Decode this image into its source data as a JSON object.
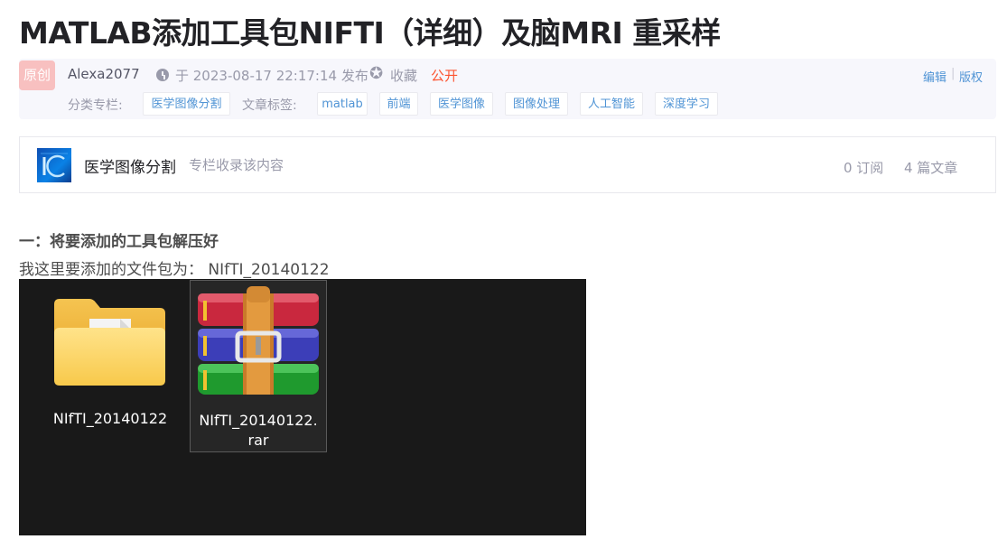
{
  "article": {
    "title": "MATLAB添加工具包NIFTI（详细）及脑MRI 重采样"
  },
  "meta": {
    "badge": "原创",
    "author": "Alexa2077",
    "time": "于 2023-08-17 22:17:14 发布",
    "collect": "收藏",
    "visibility": "公开",
    "edit": "编辑",
    "separator": "|",
    "copyright": "版权",
    "category_label": "分类专栏:",
    "categories": [
      "医学图像分割"
    ],
    "tags_label": "文章标签:",
    "tags": [
      "matlab",
      "前端",
      "医学图像",
      "图像处理",
      "人工智能",
      "深度学习"
    ]
  },
  "column": {
    "name": "医学图像分割",
    "desc": "专栏收录该内容",
    "subscriptions": "0 订阅",
    "articles": "4 篇文章"
  },
  "content": {
    "heading": "一：将要添加的工具包解压好",
    "paragraph": "我这里要添加的文件包为： NIfTI_20140122"
  },
  "explorer": {
    "files": [
      {
        "name": "NIfTI_20140122",
        "icon": "folder-icon"
      },
      {
        "name_line1": "NIfTI_20140122.",
        "name_line2": "rar",
        "icon": "winrar-archive-icon"
      }
    ]
  }
}
